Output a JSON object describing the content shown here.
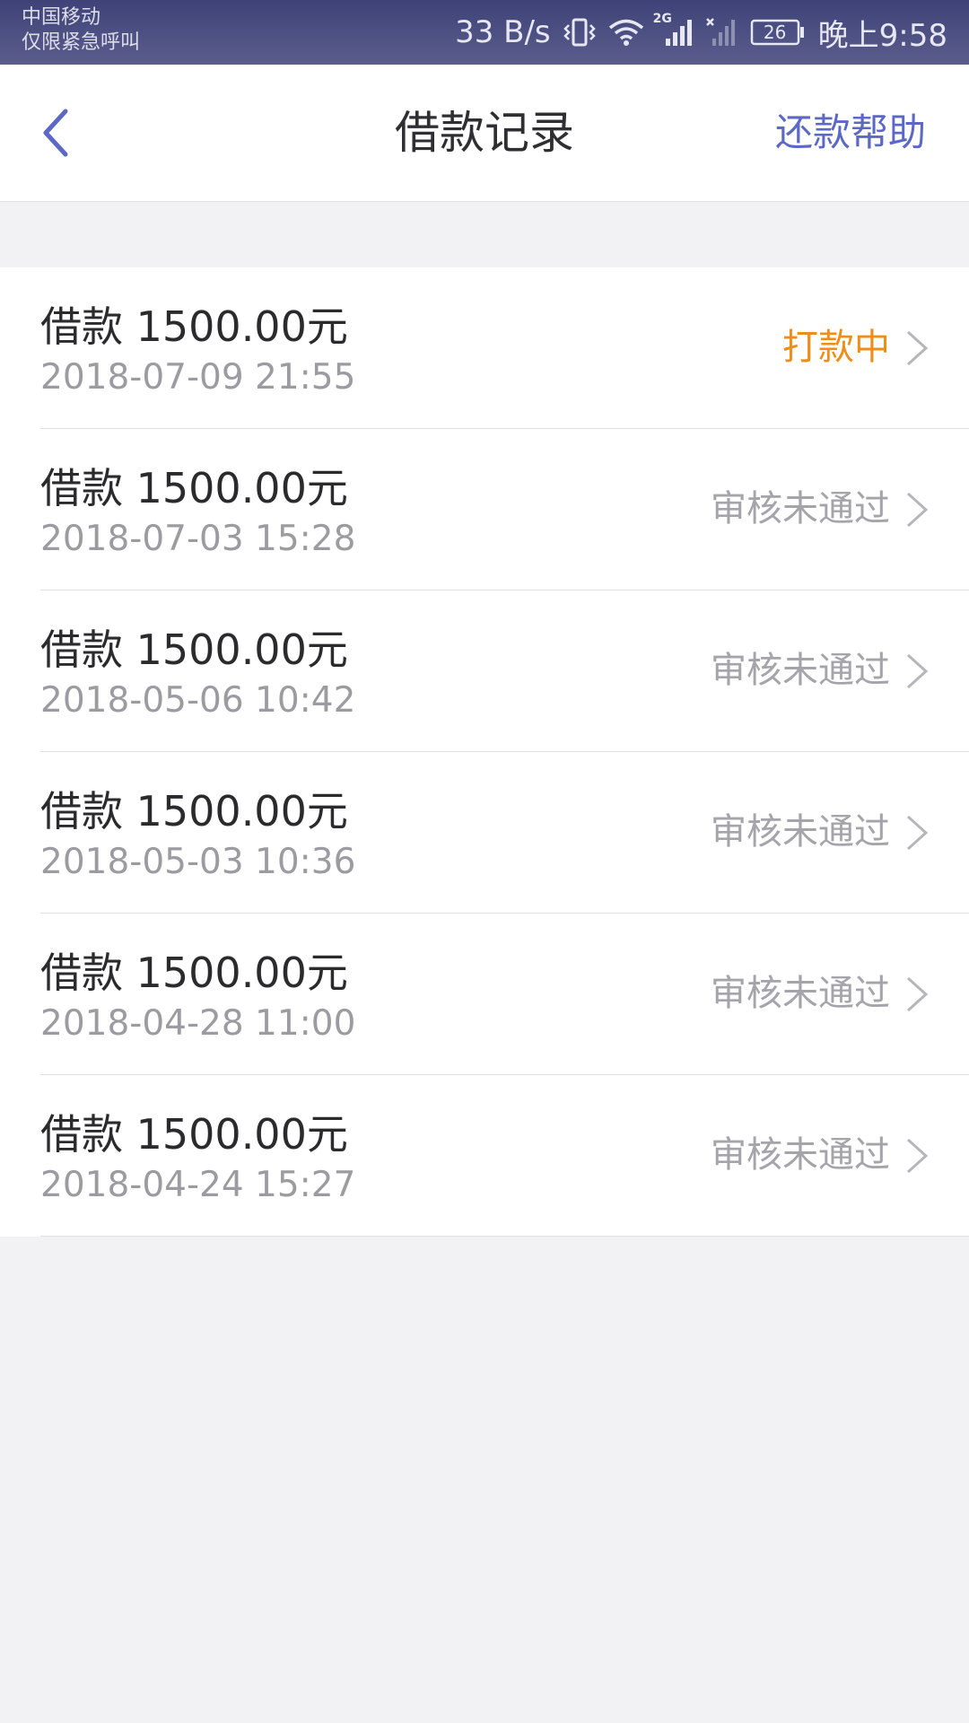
{
  "status_bar": {
    "carrier": "中国移动",
    "emergency": "仅限紧急呼叫",
    "net_speed": "33 B/s",
    "network_type": "2G",
    "battery": "26",
    "time": "晚上9:58",
    "icons": [
      "vibrate-icon",
      "wifi-icon",
      "signal-icon",
      "no-signal-icon",
      "battery-icon"
    ]
  },
  "header": {
    "back_icon": "chevron-left-icon",
    "title": "借款记录",
    "help_label": "还款帮助"
  },
  "colors": {
    "accent": "#5b68c5",
    "pending": "#ec8e1b",
    "rejected": "#a4a4aa",
    "background": "#f2f2f5"
  },
  "records": [
    {
      "amount": "借款 1500.00元",
      "time": "2018-07-09 21:55",
      "status": "打款中"
    },
    {
      "amount": "借款 1500.00元",
      "time": "2018-07-03 15:28",
      "status": "审核未通过"
    },
    {
      "amount": "借款 1500.00元",
      "time": "2018-05-06 10:42",
      "status": "审核未通过"
    },
    {
      "amount": "借款 1500.00元",
      "time": "2018-05-03 10:36",
      "status": "审核未通过"
    },
    {
      "amount": "借款 1500.00元",
      "time": "2018-04-28 11:00",
      "status": "审核未通过"
    },
    {
      "amount": "借款 1500.00元",
      "time": "2018-04-24 15:27",
      "status": "审核未通过"
    }
  ]
}
